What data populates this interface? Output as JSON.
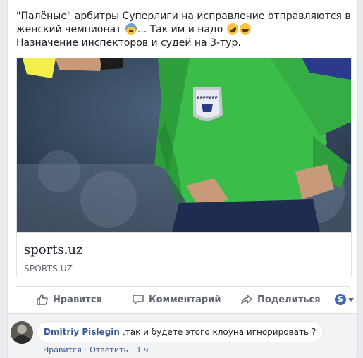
{
  "post": {
    "line1": "\"Палёные\" арбитры Суперлиги на исправление отправляются в",
    "line2_text": "женский чемпионат",
    "line2_mid": "... Так им и надо",
    "line3": "Назначение инспекторов и судей на 3-тур.",
    "emojis": [
      "fearful-face-emoji",
      "rofl-emoji",
      "smiling-face-emoji"
    ]
  },
  "link_preview": {
    "title": "sports.uz",
    "domain": "SPORTS.UZ",
    "image_badge": "REFEREE"
  },
  "actions": {
    "like": "Нравится",
    "comment": "Комментарий",
    "share": "Поделиться",
    "audience_icon": "S"
  },
  "comment": {
    "author": "Dmitriy Pislegin",
    "text": ",так и будете этого клоуна игнорировать ?",
    "like_label": "Нравится",
    "reply_label": "Ответить",
    "time": "1 ч"
  },
  "colors": {
    "link": "#385898",
    "muted": "#606770",
    "jersey": "#3bbd4a",
    "yellow_card": "#f2ee4a"
  }
}
